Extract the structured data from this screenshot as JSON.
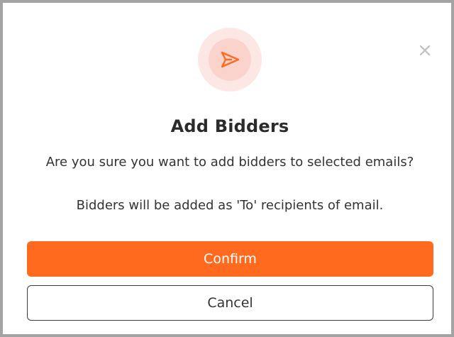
{
  "dialog": {
    "title": "Add Bidders",
    "question": "Are you sure you want to add bidders to selected emails?",
    "note": "Bidders will be added as 'To' recipients of email.",
    "confirm_label": "Confirm",
    "cancel_label": "Cancel",
    "header_icon": "send-icon",
    "close_icon": "close-icon"
  },
  "colors": {
    "accent": "#ff6a1f",
    "icon_halo_outer": "#fde7e4",
    "icon_halo_inner": "#fbd3cd",
    "close_icon": "#c4c4c4",
    "frame_border": "#a3a3a3"
  }
}
